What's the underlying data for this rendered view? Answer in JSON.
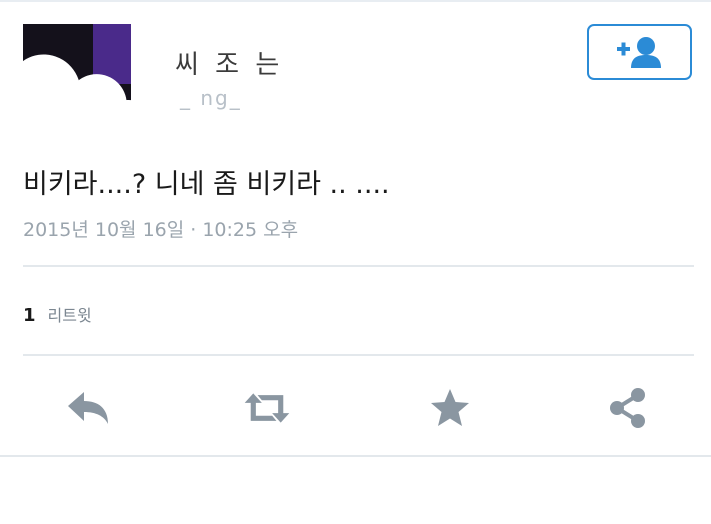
{
  "profile": {
    "display_name": "씨 조 는",
    "username": "_ ng_"
  },
  "follow_button": {
    "icon": "add-user-icon",
    "color": "#2b8bd6"
  },
  "tweet": {
    "text": "비키라....? 니네 좀 비키라 .. ....",
    "timestamp": "2015년 10월 16일 · 10:25 오후"
  },
  "stats": {
    "retweet_count": "1",
    "retweet_label": "리트윗"
  },
  "actions": [
    {
      "icon": "reply-icon"
    },
    {
      "icon": "retweet-icon"
    },
    {
      "icon": "star-icon"
    },
    {
      "icon": "share-icon"
    }
  ],
  "colors": {
    "icon_gray": "#8a96a1",
    "accent": "#2b8bd6"
  }
}
